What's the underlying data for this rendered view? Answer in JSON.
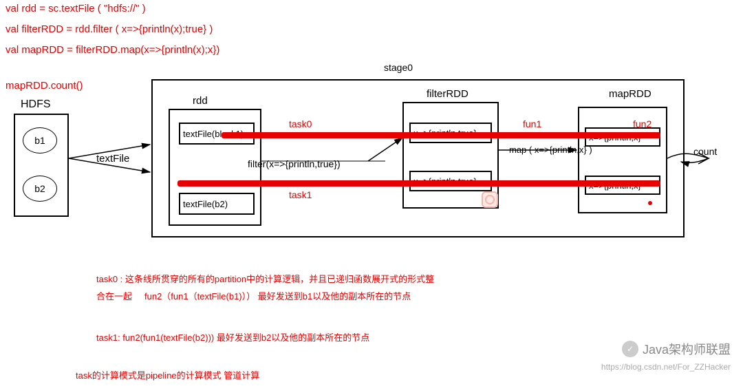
{
  "code": {
    "line1": "val rdd = sc.textFile ( \"hdfs://\" )",
    "line2": "val filterRDD = rdd.filter ( x=>{println(x);true} )",
    "line3": "val mapRDD = filterRDD.map(x=>{println(x);x})",
    "line4": "mapRDD.count()"
  },
  "labels": {
    "stage": "stage0",
    "hdfs": "HDFS",
    "b1": "b1",
    "b2": "b2",
    "textFile": "textFile",
    "rdd": "rdd",
    "filterRDD": "filterRDD",
    "mapRDD": "mapRDD",
    "count": "count",
    "task0": "task0",
    "task1": "task1",
    "fun1": "fun1",
    "fun2": "fun2",
    "filterExpr": "filter(x=>{println,true})",
    "mapExpr": "map ( x=>{println,x} )"
  },
  "partitions": {
    "rdd_p1": "textFile(block1)",
    "rdd_p2": "textFile(b2)",
    "filter_p1": "x=>{println,true}",
    "filter_p2": "x=>{println,true}",
    "map_p1": "x=>{println,x}",
    "map_p2": "x=>{println,x}"
  },
  "notes": {
    "n1a": "task0 : 这条线所贯穿的所有的partition中的计算逻辑，并且已递归函数展开式的形式整",
    "n1b": "合在一起",
    "n1c": "fun2（fun1（textFile(b1)））  最好发送到b1以及他的副本所在的节点",
    "n2": "task1: fun2(fun1(textFile(b2))) 最好发送到b2以及他的副本所在的节点",
    "n3": "task的计算模式是pipeline的计算模式  管道计算"
  },
  "watermark": {
    "logo": "Java架构师联盟",
    "url": "https://blog.csdn.net/For_ZZHacker"
  }
}
